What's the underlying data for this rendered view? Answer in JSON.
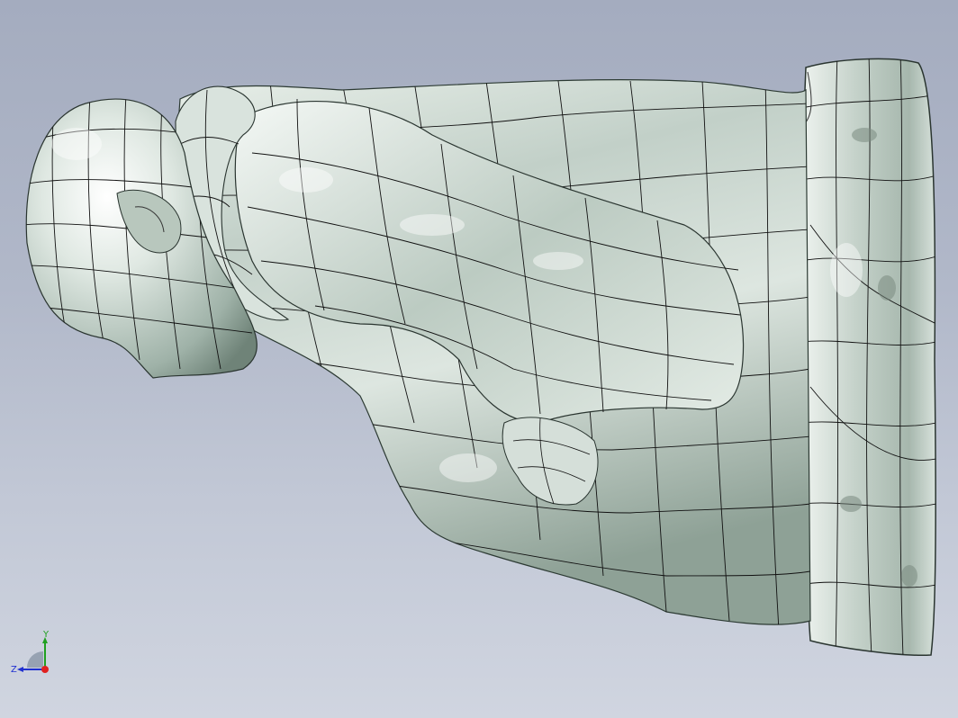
{
  "viewport": {
    "background_top": "#a4acbf",
    "background_bottom": "#d0d5e0",
    "model": {
      "name": "bust-sculpture-surface-mesh",
      "surface_color": "#c9d6cf",
      "wire_color": "#111111"
    }
  },
  "triad": {
    "y_label": "Y",
    "z_label": "Z",
    "x_color": "#e02020",
    "y_color": "#20a020",
    "z_color": "#2030d0"
  }
}
